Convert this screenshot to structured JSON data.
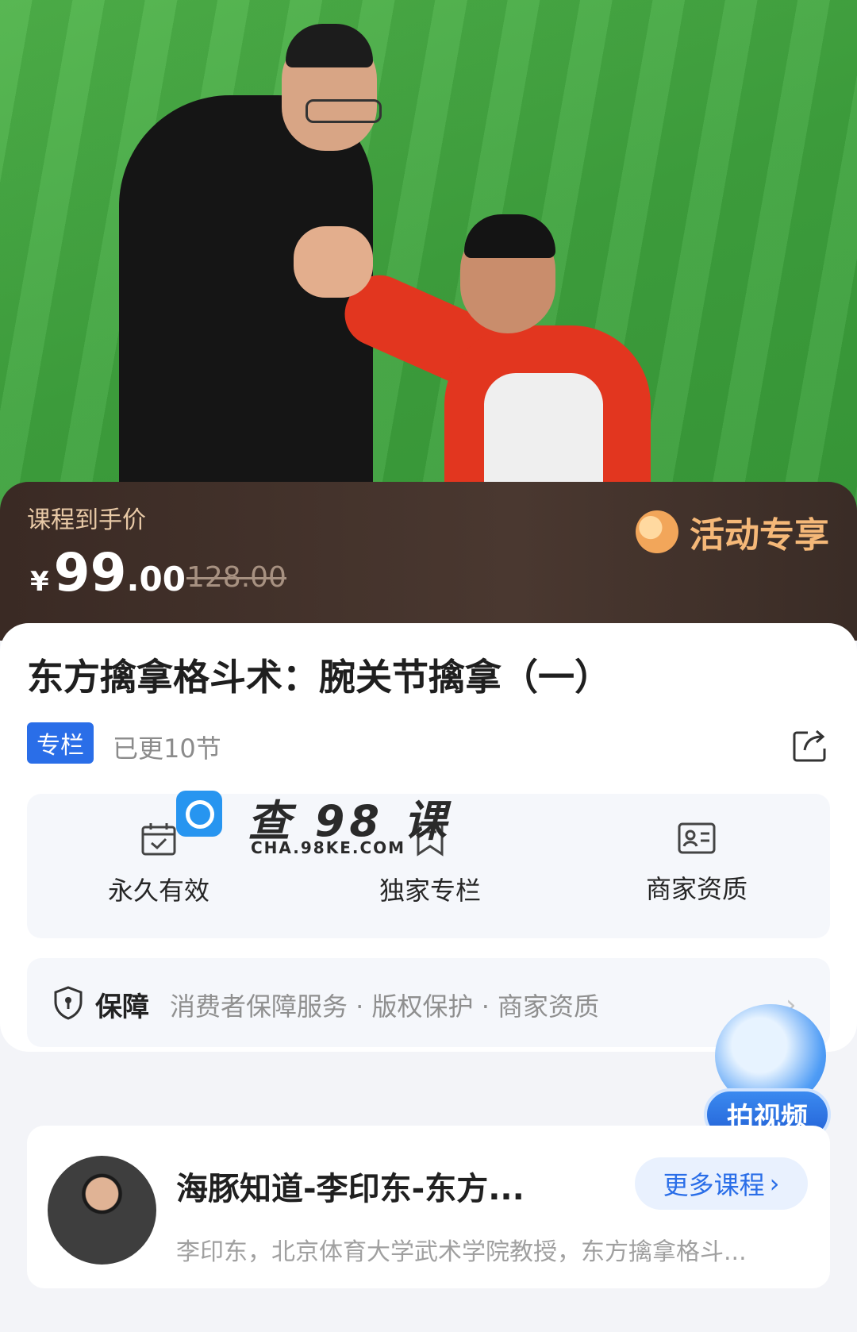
{
  "price": {
    "label": "课程到手价",
    "currency": "¥",
    "integer": "99",
    "decimal": ".00",
    "original": "128.00",
    "activity": "活动专享"
  },
  "course": {
    "title": "东方擒拿格斗术：腕关节擒拿（一）",
    "tag": "专栏",
    "updated": "已更10节"
  },
  "features": [
    {
      "label": "永久有效",
      "icon": "calendar-check-icon"
    },
    {
      "label": "独家专栏",
      "icon": "bookmark-icon"
    },
    {
      "label": "商家资质",
      "icon": "id-card-icon"
    }
  ],
  "guarantee": {
    "title": "保障",
    "text": "消费者保障服务 · 版权保护 · 商家资质"
  },
  "watermark": {
    "text": "查 98 课",
    "sub": "CHA.98KE.COM"
  },
  "float_button": {
    "label": "拍视频"
  },
  "author": {
    "name": "海豚知道-李印东-东方...",
    "more": "更多课程",
    "desc": "李印东，北京体育大学武术学院教授，东方擒拿格斗..."
  },
  "colors": {
    "accent": "#2a6ee8",
    "price_bar": "#3a2a24",
    "activity": "#f5b878"
  }
}
